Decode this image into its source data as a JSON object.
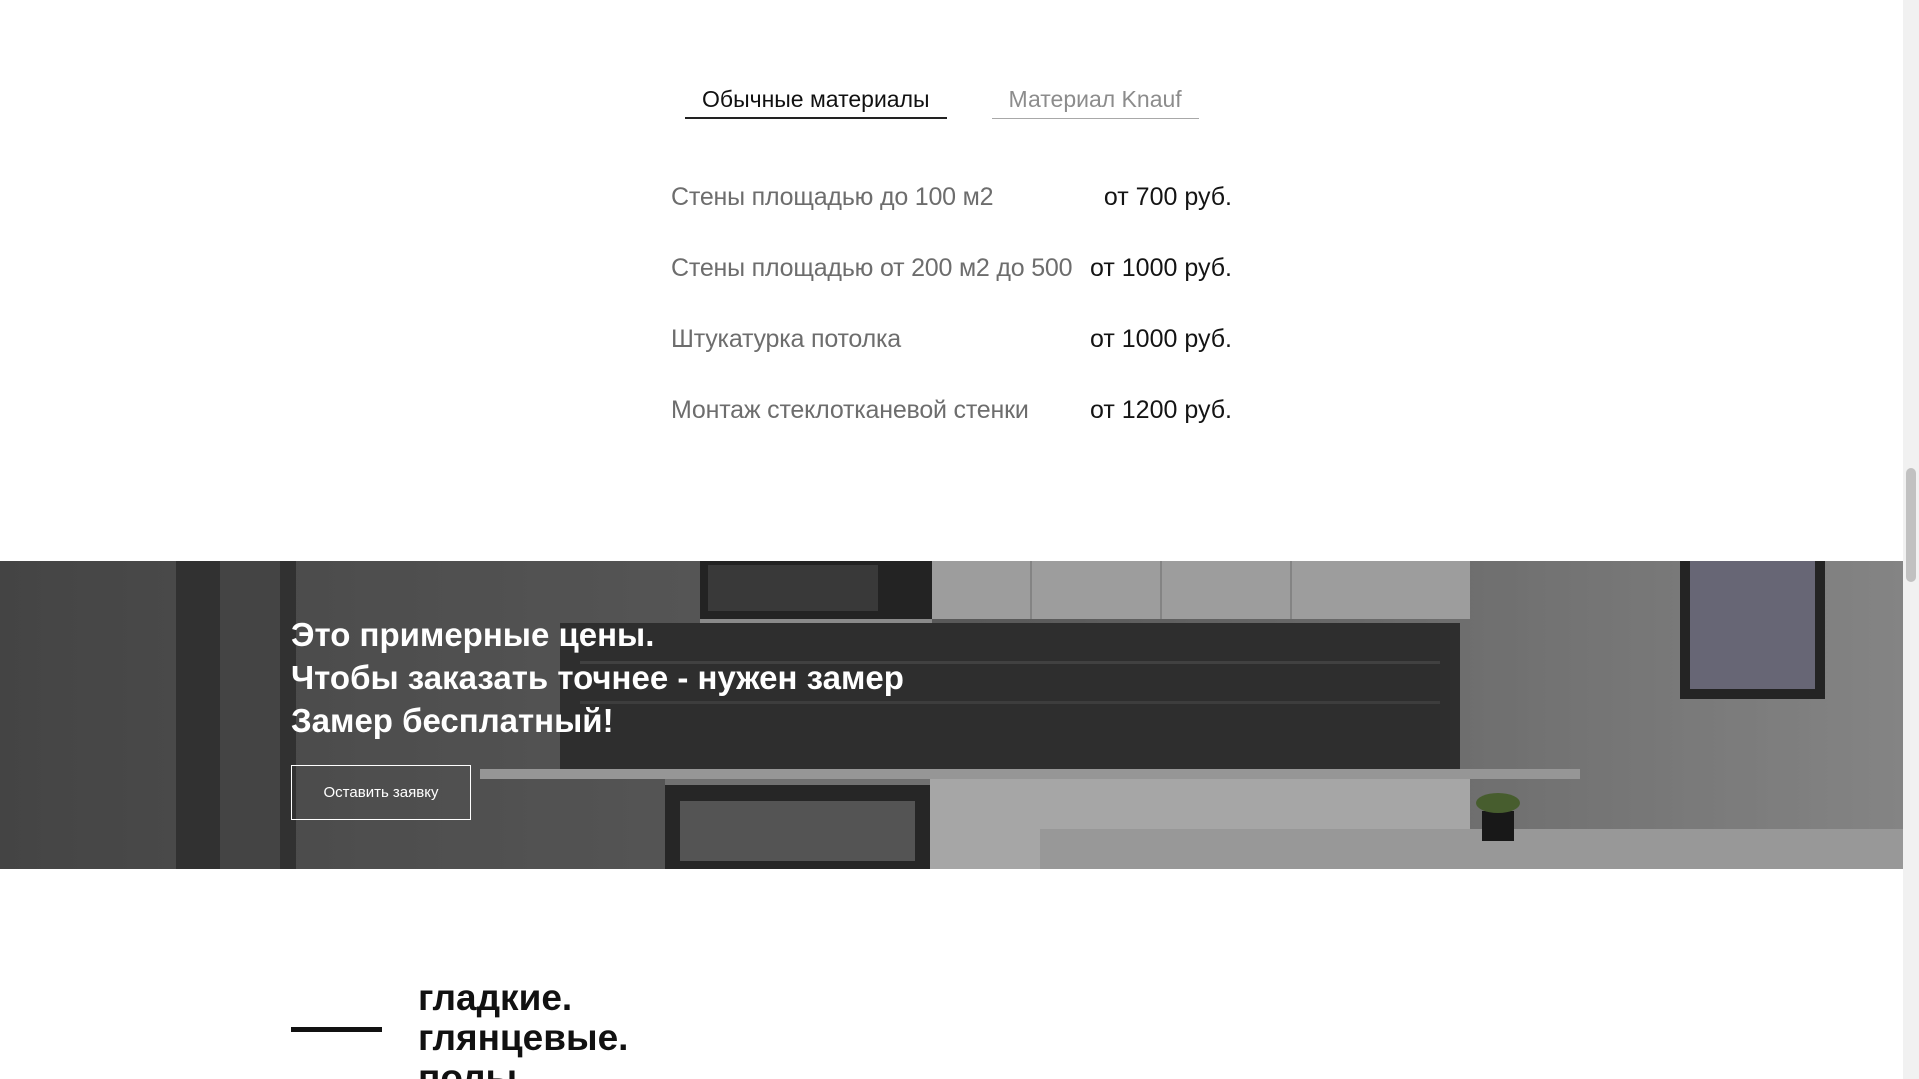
{
  "tabs": [
    {
      "label": "Обычные материалы",
      "active": true
    },
    {
      "label": "Материал Knauf",
      "active": false
    }
  ],
  "prices": [
    {
      "name": "Стены площадью до 100 м2",
      "value": "от 700 руб."
    },
    {
      "name": "Стены площадью от 200 м2 до 500",
      "value": "от 1000 руб."
    },
    {
      "name": "Штукатурка потолка",
      "value": "от 1000 руб."
    },
    {
      "name": "Монтаж стеклотканевой стенки",
      "value": "от 1200 руб."
    }
  ],
  "banner": {
    "lines": [
      "Это примерные цены.",
      "Чтобы заказать точнее - нужен замер",
      "Замер бесплатный!"
    ],
    "button_label": "Оставить заявку",
    "background_image": "kitchen-photo"
  },
  "section": {
    "title_lines": [
      "гладкие.",
      "глянцевые.",
      "полы."
    ]
  },
  "colors": {
    "text": "#111111",
    "muted": "#6d6d6d",
    "tab_inactive": "#8c8c8c",
    "banner_text": "#ffffff"
  }
}
